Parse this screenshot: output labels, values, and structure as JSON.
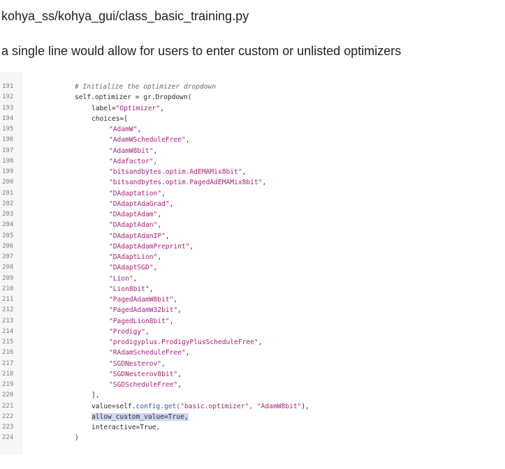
{
  "header": {
    "file_path": "kohya_ss/kohya_gui/class_basic_training.py",
    "description": "a single line would allow for users to enter custom or unlisted optimizers"
  },
  "code": {
    "partial_line_number": "190",
    "lines": [
      {
        "num": "191",
        "indent": "ind0",
        "type": "comment",
        "text": "# Initialize the optimizer dropdown"
      },
      {
        "num": "192",
        "indent": "ind0",
        "type": "plain",
        "text": "self.optimizer = gr.Dropdown("
      },
      {
        "num": "193",
        "indent": "ind1",
        "type": "kv",
        "key": "label=",
        "value": "\"Optimizer\"",
        "tail": ","
      },
      {
        "num": "194",
        "indent": "ind1",
        "type": "plain",
        "text": "choices=["
      },
      {
        "num": "195",
        "indent": "ind2",
        "type": "str",
        "text": "\"AdamW\"",
        "tail": ","
      },
      {
        "num": "196",
        "indent": "ind2",
        "type": "str",
        "text": "\"AdamWScheduleFree\"",
        "tail": ","
      },
      {
        "num": "197",
        "indent": "ind2",
        "type": "str",
        "text": "\"AdamW8bit\"",
        "tail": ","
      },
      {
        "num": "198",
        "indent": "ind2",
        "type": "str",
        "text": "\"Adafactor\"",
        "tail": ","
      },
      {
        "num": "199",
        "indent": "ind2",
        "type": "str",
        "text": "\"bitsandbytes.optim.AdEMAMix8bit\"",
        "tail": ","
      },
      {
        "num": "200",
        "indent": "ind2",
        "type": "str",
        "text": "\"bitsandbytes.optim.PagedAdEMAMix8bit\"",
        "tail": ","
      },
      {
        "num": "201",
        "indent": "ind2",
        "type": "str",
        "text": "\"DAdaptation\"",
        "tail": ","
      },
      {
        "num": "202",
        "indent": "ind2",
        "type": "str",
        "text": "\"DAdaptAdaGrad\"",
        "tail": ","
      },
      {
        "num": "203",
        "indent": "ind2",
        "type": "str",
        "text": "\"DAdaptAdam\"",
        "tail": ","
      },
      {
        "num": "204",
        "indent": "ind2",
        "type": "str",
        "text": "\"DAdaptAdan\"",
        "tail": ","
      },
      {
        "num": "205",
        "indent": "ind2",
        "type": "str",
        "text": "\"DAdaptAdanIP\"",
        "tail": ","
      },
      {
        "num": "206",
        "indent": "ind2",
        "type": "str",
        "text": "\"DAdaptAdamPreprint\"",
        "tail": ","
      },
      {
        "num": "207",
        "indent": "ind2",
        "type": "str",
        "text": "\"DAdaptLion\"",
        "tail": ","
      },
      {
        "num": "208",
        "indent": "ind2",
        "type": "str",
        "text": "\"DAdaptSGD\"",
        "tail": ","
      },
      {
        "num": "209",
        "indent": "ind2",
        "type": "str",
        "text": "\"Lion\"",
        "tail": ","
      },
      {
        "num": "210",
        "indent": "ind2",
        "type": "str",
        "text": "\"Lion8bit\"",
        "tail": ","
      },
      {
        "num": "211",
        "indent": "ind2",
        "type": "str",
        "text": "\"PagedAdamW8bit\"",
        "tail": ","
      },
      {
        "num": "212",
        "indent": "ind2",
        "type": "str",
        "text": "\"PagedAdamW32bit\"",
        "tail": ","
      },
      {
        "num": "213",
        "indent": "ind2",
        "type": "str",
        "text": "\"PagedLion8bit\"",
        "tail": ","
      },
      {
        "num": "214",
        "indent": "ind2",
        "type": "str",
        "text": "\"Prodigy\"",
        "tail": ","
      },
      {
        "num": "215",
        "indent": "ind2",
        "type": "str",
        "text": "\"prodigyplus.ProdigyPlusScheduleFree\"",
        "tail": ","
      },
      {
        "num": "216",
        "indent": "ind2",
        "type": "str",
        "text": "\"RAdamScheduleFree\"",
        "tail": ","
      },
      {
        "num": "217",
        "indent": "ind2",
        "type": "str",
        "text": "\"SGDNesterov\"",
        "tail": ","
      },
      {
        "num": "218",
        "indent": "ind2",
        "type": "str",
        "text": "\"SGDNesterov8bit\"",
        "tail": ","
      },
      {
        "num": "219",
        "indent": "ind2",
        "type": "str",
        "text": "\"SGDScheduleFree\"",
        "tail": ","
      },
      {
        "num": "220",
        "indent": "ind1",
        "type": "plain",
        "text": "],"
      },
      {
        "num": "221",
        "indent": "ind1",
        "type": "call",
        "pre": "value=self.",
        "kw": "config.get(",
        "value": "\"basic.optimizer\", \"AdamW8bit\"",
        "tail": "),"
      },
      {
        "num": "222",
        "indent": "ind1",
        "type": "highlight",
        "text": "allow_custom_value=True,"
      },
      {
        "num": "223",
        "indent": "ind1",
        "type": "plain",
        "text": "interactive=True,"
      },
      {
        "num": "224",
        "indent": "indx",
        "type": "plain",
        "text": ")"
      }
    ]
  },
  "colors": {
    "string": "#a0247a",
    "comment": "#6a6a6a",
    "highlight": "#d3d6f2",
    "gutter_bg": "#f7f7f7"
  }
}
